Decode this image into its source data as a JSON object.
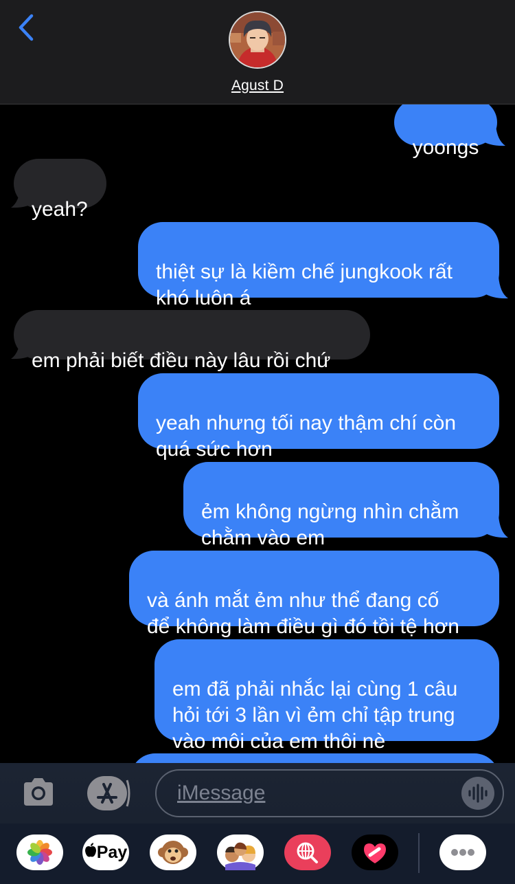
{
  "header": {
    "contact_name": "Agust D"
  },
  "messages": [
    {
      "from": "me",
      "text": "yoongs"
    },
    {
      "from": "them",
      "text": "yeah?"
    },
    {
      "from": "me",
      "text": "thiệt sự là kiềm chế jungkook rất\nkhó luôn á"
    },
    {
      "from": "them",
      "text": "em phải biết điều này lâu rồi chứ"
    },
    {
      "from": "me",
      "text": "yeah nhưng tối nay thậm chí còn\nquá sức hơn"
    },
    {
      "from": "me",
      "text": "ẻm không ngừng nhìn chằm\nchằm vào em"
    },
    {
      "from": "me",
      "text": "và ánh mắt ẻm như thể đang cố\nđể không làm điều gì đó tồi tệ hơn"
    },
    {
      "from": "me",
      "text": "em đã phải nhắc lại cùng 1 câu\nhỏi tới 3 lần vì ẻm chỉ tập trung\nvào môi của em thôi nè"
    }
  ],
  "composer": {
    "placeholder": "iMessage"
  },
  "app_drawer": {
    "apple_pay_label": "Pay",
    "apps": [
      "photos-icon",
      "apple-pay-icon",
      "animoji-monkey-icon",
      "memoji-stickers-icon",
      "web-images-search-icon",
      "digital-touch-icon",
      "more-apps-icon"
    ]
  },
  "colors": {
    "sent_bubble": "#3b82f7",
    "received_bubble": "#262629",
    "accent": "#3b82f7"
  }
}
